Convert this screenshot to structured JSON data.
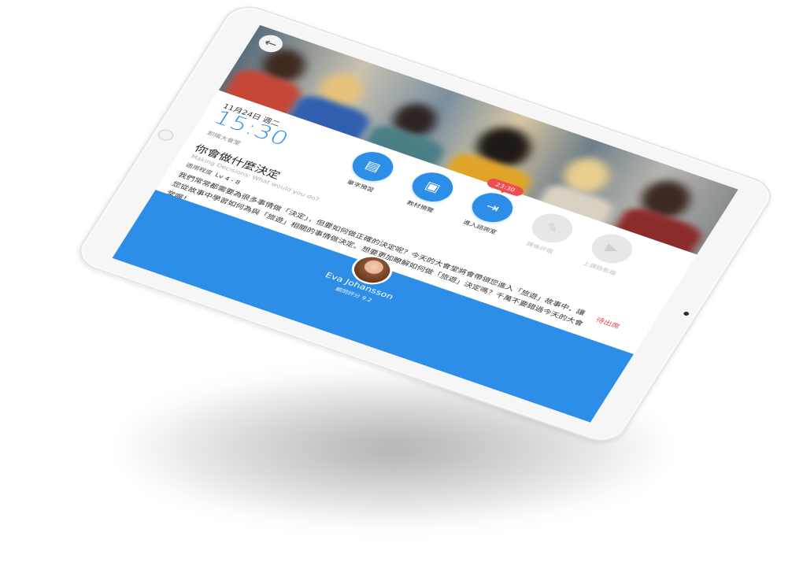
{
  "header": {
    "back_icon": "arrow-left-icon"
  },
  "schedule": {
    "date": "11月24日 週二",
    "time": "15:30",
    "room": "卸陽大會堂"
  },
  "course": {
    "title_zh": "你會做什麼決定",
    "title_en": "Making Decisions: What would you do?",
    "level_label": "適用程度",
    "level_value": "Lv 4 - 8",
    "description": "我們常常都需要為很多事情做「決定」，但要如何做正確的決定呢？今天的大會堂將會帶領您進入「旅遊」故事中，讓您從故事中學習如何為與「旅遊」相關的事情做決定。想要更加瞭解如何做「旅遊」決定嗎？千萬不要錯過今天的大會堂喔！",
    "status": "待出席"
  },
  "actions": [
    {
      "label": "單字預習",
      "icon": "vocabulary-icon",
      "enabled": true
    },
    {
      "label": "教材預覽",
      "icon": "book-icon",
      "enabled": true
    },
    {
      "label": "進入諮詢室",
      "icon": "enter-room-icon",
      "enabled": true,
      "badge": "23:30"
    },
    {
      "label": "課後評鑑",
      "icon": "pen-icon",
      "enabled": false
    },
    {
      "label": "上課錄影檔",
      "icon": "video-icon",
      "enabled": false
    }
  ],
  "teacher": {
    "name": "Eva Johansson",
    "rating_label": "顧問評分",
    "rating_value": "9.2"
  },
  "colors": {
    "accent": "#2d8ee8",
    "badge": "#ee4d52",
    "status": "#e8434a",
    "disabled": "#e7e7e7"
  }
}
